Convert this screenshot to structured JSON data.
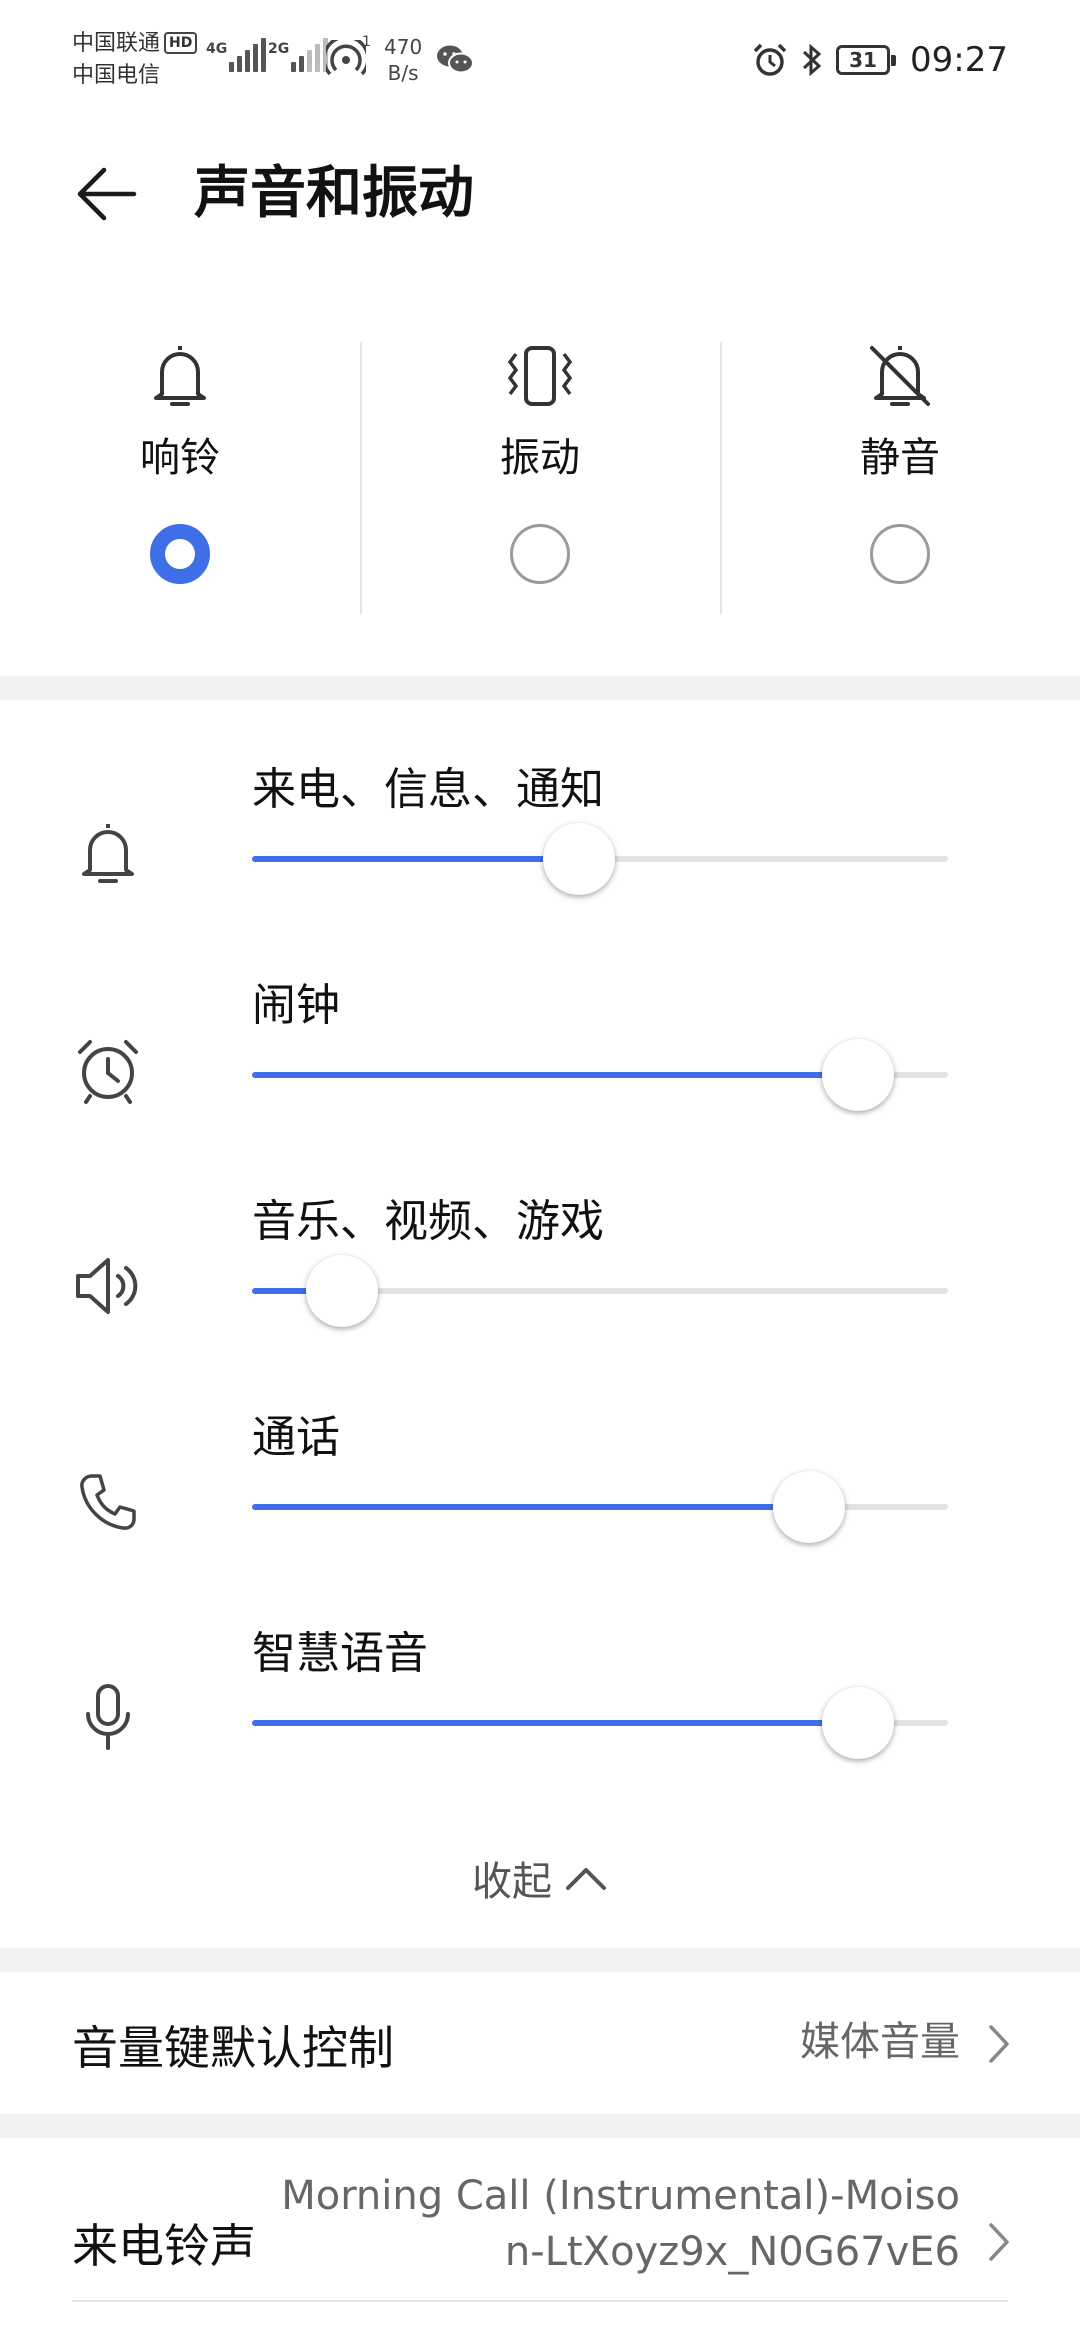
{
  "status_bar": {
    "carrier_1": "中国联通",
    "carrier_2": "中国电信",
    "hd_badge": "HD",
    "sim1_tech": "4G",
    "sim2_tech": "2G",
    "hotspot_count": "1",
    "net_speed_value": "470",
    "net_speed_unit": "B/s",
    "battery_level": "31",
    "time": "09:27",
    "icons": [
      "alarm-icon",
      "bluetooth-icon",
      "battery-icon",
      "wechat-icon",
      "hotspot-icon"
    ]
  },
  "header": {
    "title": "声音和振动"
  },
  "modes": [
    {
      "label": "响铃",
      "icon": "bell-icon",
      "selected": true
    },
    {
      "label": "振动",
      "icon": "vibrate-icon",
      "selected": false
    },
    {
      "label": "静音",
      "icon": "bell-off-icon",
      "selected": false
    }
  ],
  "volumes": [
    {
      "label": "来电、信息、通知",
      "icon": "bell-icon",
      "level": 0.47
    },
    {
      "label": "闹钟",
      "icon": "alarm-icon",
      "level": 0.87
    },
    {
      "label": "音乐、视频、游戏",
      "icon": "speaker-icon",
      "level": 0.13
    },
    {
      "label": "通话",
      "icon": "phone-icon",
      "level": 0.8
    },
    {
      "label": "智慧语音",
      "icon": "mic-icon",
      "level": 0.87
    }
  ],
  "collapse_label": "收起",
  "settings": {
    "volume_key": {
      "label": "音量键默认控制",
      "value": "媒体音量"
    },
    "ringtone": {
      "label": "来电铃声",
      "value_line1": "Morning Call (Instrumental)-Moiso",
      "value_line2": "n-LtXoyz9x_N0G67vE6"
    }
  },
  "colors": {
    "accent": "#3f6fe6",
    "track": "#e3e3e3",
    "separator": "#f2f2f2"
  }
}
